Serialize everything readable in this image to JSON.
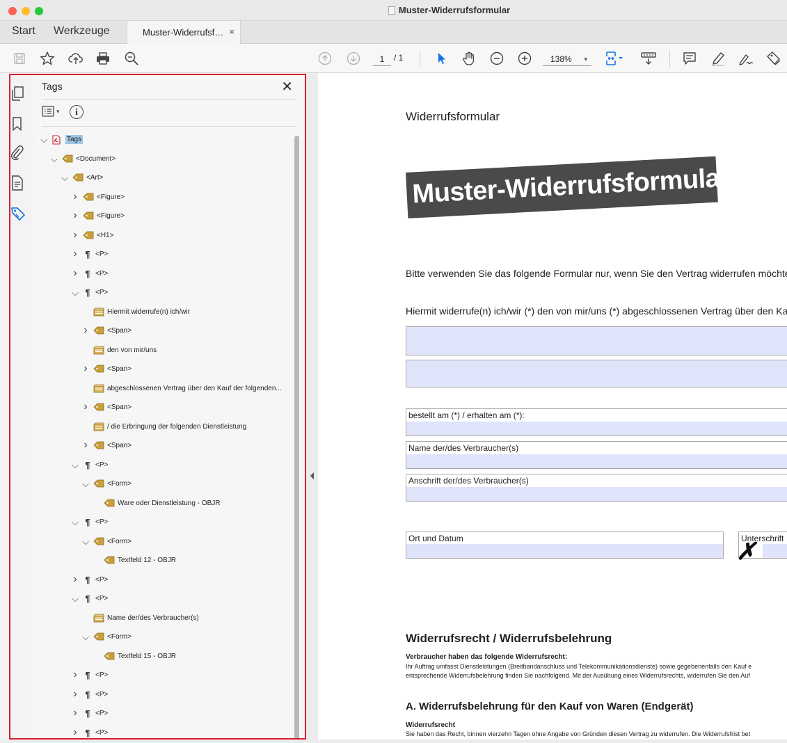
{
  "window": {
    "title": "Muster-Widerrufsformular"
  },
  "tabs": {
    "start": "Start",
    "tools": "Werkzeuge",
    "document": "Muster-Widerrufsf…",
    "close": "×"
  },
  "toolbar": {
    "page_current": "1",
    "page_total": "/ 1",
    "zoom": "138%",
    "zoom_caret": "▾",
    "icons": [
      "save-icon",
      "star-icon",
      "cloud-upload-icon",
      "print-icon",
      "search-zoom-icon",
      "page-up-icon",
      "page-down-icon",
      "select-cursor-icon",
      "hand-icon",
      "zoom-out-icon",
      "zoom-in-icon",
      "fit-page-icon",
      "scroll-mode-icon",
      "comment-icon",
      "highlight-pen-icon",
      "sign-icon",
      "stamp-icon"
    ]
  },
  "left_rail": {
    "icons": [
      "pages-icon",
      "bookmarks-icon",
      "attachments-icon",
      "content-icon",
      "tags-icon"
    ]
  },
  "tags_panel": {
    "title": "Tags",
    "close": "✕",
    "options_caret": "▾",
    "info": "i",
    "tree": [
      {
        "label": "Tags",
        "level": 0,
        "expanded": true,
        "icon": "pdf",
        "selected": true
      },
      {
        "label": "<Document>",
        "level": 1,
        "expanded": true,
        "icon": "tag"
      },
      {
        "label": "<Art>",
        "level": 2,
        "expanded": true,
        "icon": "tag"
      },
      {
        "label": "<Figure>",
        "level": 3,
        "expanded": false,
        "icon": "tag"
      },
      {
        "label": "<Figure>",
        "level": 3,
        "expanded": false,
        "icon": "tag"
      },
      {
        "label": "<H1>",
        "level": 3,
        "expanded": false,
        "icon": "tag"
      },
      {
        "label": "<P>",
        "level": 3,
        "expanded": false,
        "icon": "para"
      },
      {
        "label": "<P>",
        "level": 3,
        "expanded": false,
        "icon": "para"
      },
      {
        "label": "<P>",
        "level": 3,
        "expanded": true,
        "icon": "para"
      },
      {
        "label": "Hiermit widerrufe(n) ich/wir",
        "level": 4,
        "expanded": null,
        "icon": "content"
      },
      {
        "label": "<Span>",
        "level": 4,
        "expanded": false,
        "icon": "tag"
      },
      {
        "label": "den von mir/uns",
        "level": 4,
        "expanded": null,
        "icon": "content"
      },
      {
        "label": "<Span>",
        "level": 4,
        "expanded": false,
        "icon": "tag"
      },
      {
        "label": "abgeschlossenen Vertrag über den Kauf der folgenden...",
        "level": 4,
        "expanded": null,
        "icon": "content"
      },
      {
        "label": "<Span>",
        "level": 4,
        "expanded": false,
        "icon": "tag"
      },
      {
        "label": "/ die Erbringung der folgenden Dienstleistung",
        "level": 4,
        "expanded": null,
        "icon": "content"
      },
      {
        "label": "<Span>",
        "level": 4,
        "expanded": false,
        "icon": "tag"
      },
      {
        "label": "<P>",
        "level": 3,
        "expanded": true,
        "icon": "para"
      },
      {
        "label": "<Form>",
        "level": 4,
        "expanded": true,
        "icon": "tag"
      },
      {
        "label": "Ware oder Dienstleistung - OBJR",
        "level": 5,
        "expanded": null,
        "icon": "tag"
      },
      {
        "label": "<P>",
        "level": 3,
        "expanded": true,
        "icon": "para"
      },
      {
        "label": "<Form>",
        "level": 4,
        "expanded": true,
        "icon": "tag"
      },
      {
        "label": "Textfeld 12 - OBJR",
        "level": 5,
        "expanded": null,
        "icon": "tag"
      },
      {
        "label": "<P>",
        "level": 3,
        "expanded": false,
        "icon": "para"
      },
      {
        "label": "<P>",
        "level": 3,
        "expanded": true,
        "icon": "para"
      },
      {
        "label": "Name der/des Verbraucher(s)",
        "level": 4,
        "expanded": null,
        "icon": "content"
      },
      {
        "label": "<Form>",
        "level": 4,
        "expanded": true,
        "icon": "tag"
      },
      {
        "label": "Textfeld 15 - OBJR",
        "level": 5,
        "expanded": null,
        "icon": "tag"
      },
      {
        "label": "<P>",
        "level": 3,
        "expanded": false,
        "icon": "para"
      },
      {
        "label": "<P>",
        "level": 3,
        "expanded": false,
        "icon": "para"
      },
      {
        "label": "<P>",
        "level": 3,
        "expanded": false,
        "icon": "para"
      },
      {
        "label": "<P>",
        "level": 3,
        "expanded": false,
        "icon": "para"
      }
    ]
  },
  "document": {
    "heading_small": "Widerrufsformular",
    "banner": "Muster-Widerrufsformular",
    "instruction": "Bitte verwenden Sie das folgende Formular nur, wenn Sie den Vertrag widerrufen möchten.",
    "revocation_line": "Hiermit widerrufe(n) ich/wir (*) den von mir/uns (*) abgeschlossenen Vertrag über den Kauf der fo",
    "field_ordered": "bestellt am (*) / erhalten am (*):",
    "field_name": "Name der/des Verbraucher(s)",
    "field_address": "Anschrift der/des Verbraucher(s)",
    "field_place_date": "Ort und Datum",
    "field_signature": "Unterschrift",
    "signature_mark": "✗",
    "section_title": "Widerrufsrecht / Widerrufsbelehrung",
    "consumer_heading": "Verbraucher haben das folgende Widerrufsrecht:",
    "consumer_line1": "Ihr Auftrag umfasst Dienstleistungen (Breitbandanschluss und Telekommunikationsdienste) sowie gegebenenfalls den Kauf e",
    "consumer_line2": "entsprechende Widerrufsbelehrung finden Sie nachfolgend. Mit der Ausübung eines Widerrufsrechts, widerrufen Sie den Auf",
    "section_a": "A. Widerrufsbelehrung für den Kauf von Waren (Endgerät)",
    "right_heading": "Widerrufsrecht",
    "right_line": "Sie haben das Recht, binnen vierzehn Tagen ohne Angabe von Gründen diesen Vertrag zu widerrufen. Die Widerrufsfrist bet"
  },
  "colors": {
    "accent_red": "#d7202e",
    "form_fill": "#dfe4fb",
    "selection": "#9ec6e8",
    "tag_gold": "#c9a13b"
  }
}
